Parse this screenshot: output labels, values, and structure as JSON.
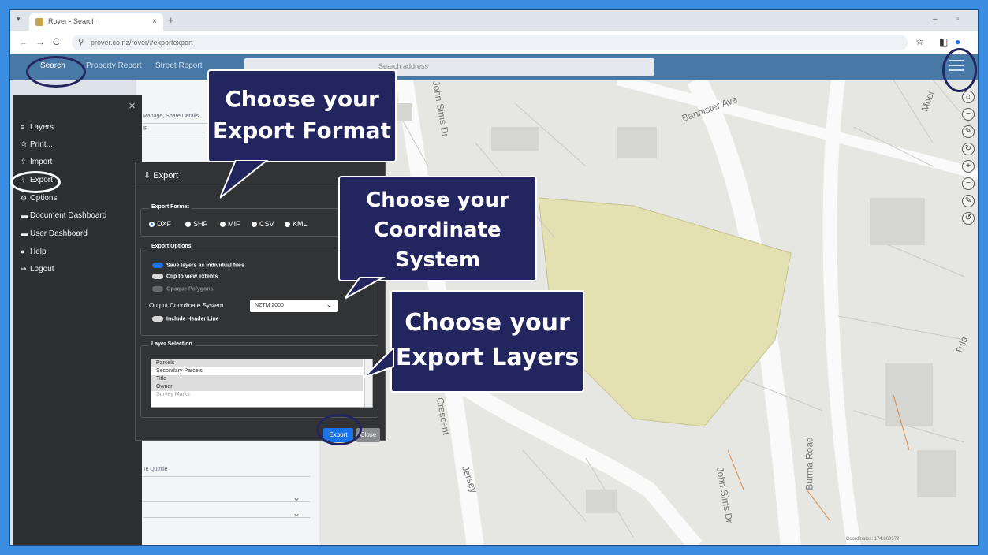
{
  "browser": {
    "tab_title": "Rover - Search",
    "tab_close": "×",
    "new_tab": "+",
    "url": "prover.co.nz/rover/#exportexport",
    "nav": {
      "back": "←",
      "forward": "→",
      "reload": "C"
    }
  },
  "app": {
    "tabs": [
      {
        "label": "Search"
      },
      {
        "label": "Property Report"
      },
      {
        "label": "Street Report"
      }
    ],
    "search_placeholder": "Search address"
  },
  "side_menu": {
    "close": "×",
    "items": [
      {
        "label": "Layers",
        "icon": "≡"
      },
      {
        "label": "Print...",
        "icon": "⎙"
      },
      {
        "label": "Import",
        "icon": "⇪"
      },
      {
        "label": "Export",
        "icon": "⇩"
      },
      {
        "label": "Options",
        "icon": "⚙"
      },
      {
        "label": "Document Dashboard",
        "icon": "▬"
      },
      {
        "label": "User Dashboard",
        "icon": "▬"
      },
      {
        "label": "Help",
        "icon": "●"
      },
      {
        "label": "Logout",
        "icon": "↦"
      }
    ]
  },
  "left_panel": {
    "row_texts": [
      "Manage, Share Details",
      "IF",
      "Te Quintie"
    ]
  },
  "dialog": {
    "title": "Export",
    "title_icon": "⇩",
    "export_format": {
      "legend": "Export Format",
      "options": [
        {
          "label": "DXF",
          "selected": true
        },
        {
          "label": "SHP",
          "selected": false
        },
        {
          "label": "MIF",
          "selected": false
        },
        {
          "label": "CSV",
          "selected": false
        },
        {
          "label": "KML",
          "selected": false
        }
      ]
    },
    "export_options": {
      "legend": "Export Options",
      "toggles": [
        {
          "label": "Save layers as individual files",
          "on": true
        },
        {
          "label": "Clip to view extents",
          "on": false
        },
        {
          "label": "Opaque Polygons",
          "on": false,
          "disabled": true
        }
      ],
      "coordinate_label": "Output Coordinate System",
      "coordinate_value": "NZTM 2000",
      "header_toggle": {
        "label": "Include Header Line",
        "on": false
      }
    },
    "layer_selection": {
      "legend": "Layer Selection",
      "layers": [
        {
          "label": "Parcels",
          "selected": true
        },
        {
          "label": "Secondary Parcels",
          "selected": false
        },
        {
          "label": "Title",
          "selected": true
        },
        {
          "label": "Owner",
          "selected": true
        },
        {
          "label": "Survey Marks",
          "selected": false,
          "dim": true
        }
      ]
    },
    "export_button": "Export",
    "close_button": "Close"
  },
  "callouts": {
    "format": [
      "Choose your",
      "Export Format"
    ],
    "coordinate": [
      "Choose your",
      "Coordinate",
      "System"
    ],
    "layers": [
      "Choose your",
      "Export Layers"
    ]
  },
  "map": {
    "streets": [
      "Bannister Ave",
      "John Sims Dr",
      "Burma Road",
      "Jersey",
      "Crescent",
      "Moor",
      "Tula"
    ],
    "tools": [
      "⌂",
      "−",
      "✎",
      "↻",
      "+",
      "−",
      "✎",
      "↺"
    ],
    "status": "Coordinates: 174.800572"
  },
  "colors": {
    "accent": "#1a73e8",
    "callout_bg": "#23255f",
    "highlight_parcel": "#e3e0b1"
  }
}
